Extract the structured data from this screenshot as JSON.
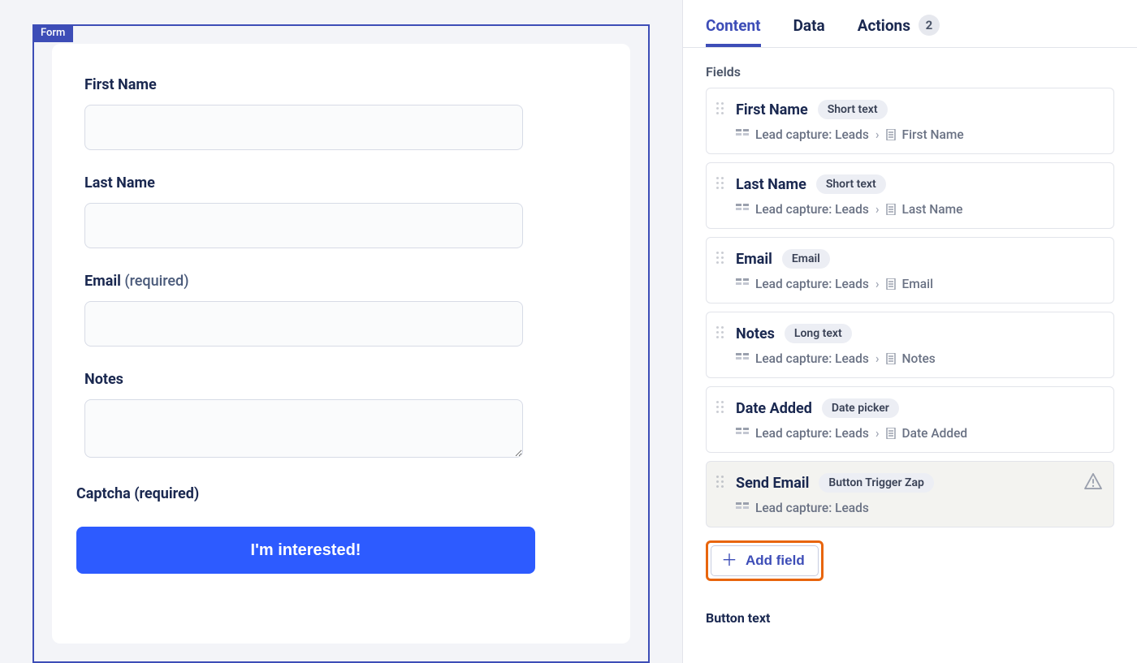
{
  "form": {
    "tag": "Form",
    "fields": [
      {
        "label": "First Name",
        "required": false,
        "type": "text"
      },
      {
        "label": "Last Name",
        "required": false,
        "type": "text"
      },
      {
        "label": "Email",
        "required": true,
        "type": "text"
      },
      {
        "label": "Notes",
        "required": false,
        "type": "textarea"
      }
    ],
    "captcha_label": "Captcha (required)",
    "required_suffix": "(required)",
    "submit_label": "I'm interested!"
  },
  "panel": {
    "tabs": {
      "content": "Content",
      "data": "Data",
      "actions": "Actions",
      "actions_count": "2"
    },
    "fields_section_label": "Fields",
    "source_table": "Lead capture: Leads",
    "fields": [
      {
        "name": "First Name",
        "type": "Short text",
        "column": "First Name",
        "warning": false,
        "muted": false
      },
      {
        "name": "Last Name",
        "type": "Short text",
        "column": "Last Name",
        "warning": false,
        "muted": false
      },
      {
        "name": "Email",
        "type": "Email",
        "column": "Email",
        "warning": false,
        "muted": false
      },
      {
        "name": "Notes",
        "type": "Long text",
        "column": "Notes",
        "warning": false,
        "muted": false
      },
      {
        "name": "Date Added",
        "type": "Date picker",
        "column": "Date Added",
        "warning": false,
        "muted": false
      },
      {
        "name": "Send Email",
        "type": "Button Trigger Zap",
        "column": null,
        "warning": true,
        "muted": true
      }
    ],
    "add_field_label": "Add field",
    "button_text_section": "Button text"
  }
}
